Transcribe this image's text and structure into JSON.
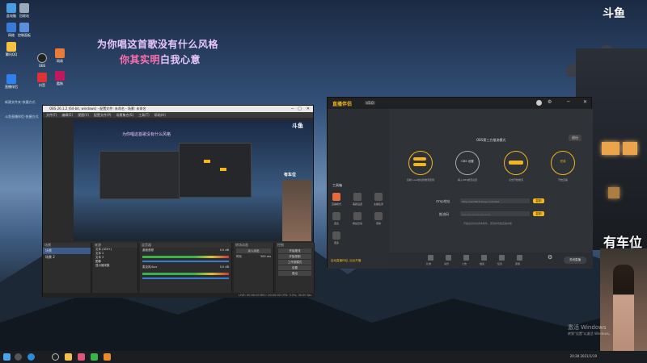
{
  "logo": "斗鱼",
  "lyrics": {
    "line1": "为你唱这首歌没有什么风格",
    "line2_part1": "你其实明",
    "line2_part2": "白我心意",
    "color1": "#e8c6ff",
    "color2": "#ff6fb0"
  },
  "desktop_icons": [
    "此电脑",
    "回收站",
    "网络",
    "控制面板",
    "腾讯QQ",
    "OBS",
    "网易",
    "抖音",
    "酷狗",
    "直播伴侣"
  ],
  "desktop_links": {
    "line1": "新建文件夹-快捷方式",
    "line2": "斗鱼直播伴侣-快捷方式"
  },
  "obs": {
    "title": "OBS 26.1.2 (64-bit, windows) - 配置文件: 未命名 - 场景: 未命名",
    "menu": [
      "文件(F)",
      "编辑(E)",
      "视图(V)",
      "配置文件(P)",
      "场景集合(S)",
      "工具(T)",
      "帮助(H)"
    ],
    "scenes_header": "场景",
    "sources_header": "来源",
    "mixer_header": "混音器",
    "transitions_header": "转场动画",
    "controls_header": "控制",
    "scenes": [
      "场景",
      "场景 2"
    ],
    "sources": [
      "文本 (GDI+)",
      "文本 2",
      "文本 3",
      "图像",
      "显示器采集"
    ],
    "mixer": [
      "桌面音频",
      "麦克风/Aux"
    ],
    "mixer_db": [
      "0.0 dB",
      "0.0 dB"
    ],
    "transition": "淡入淡出",
    "duration_label": "时长",
    "duration": "300 ms",
    "controls": [
      "开始推流",
      "开始录制",
      "工作室模式",
      "设置",
      "退出"
    ],
    "status": "LIVE: 00:00:00   REC: 00:00:00   CPU: 3.3%, 30.00 fps",
    "scene_preview_banner": "有车位"
  },
  "assistant": {
    "title": "直播伴侣",
    "version": "v5.0",
    "mode_title": "OBS第三方推流模式",
    "exit_btn": "退出",
    "sidebar_labels": [
      "工具箱",
      "直播模式",
      "美颜设置",
      "主播任务",
      "连麦",
      "粉丝互动",
      "音效",
      "更多"
    ],
    "sidebar_banner": "启动直播伴侣, 后台开播",
    "steps": [
      "复制 Live地址和推流密钥",
      "填入OBS推流设置",
      "点击开始推流",
      "开始直播"
    ],
    "step_labels": [
      "复制",
      "OBS 设置",
      "开始",
      "完成"
    ],
    "rtmp_label": "rtmp地址",
    "key_label": "推流码",
    "rtmp_value": "rtmp://sendtc3.douyu.com/live",
    "key_value": "••••••••••••••••••••",
    "copy_btn": "复制",
    "hint": "开播后请勿关闭本软件，否则将导致直播中断",
    "bottom_tools": [
      "礼物",
      "房管",
      "公告",
      "抽奖",
      "任务",
      "贵族",
      "粉丝团",
      "竞猜",
      "更多"
    ],
    "go_live_btn": "关闭直播",
    "accent": "#f3b71d"
  },
  "webcam_label": "有车位",
  "watermark": {
    "line1": "激活 Windows",
    "line2": "转到\"设置\"以激活 Windows。"
  },
  "taskbar": {
    "time": "20:28",
    "date": "2021/1/19"
  }
}
